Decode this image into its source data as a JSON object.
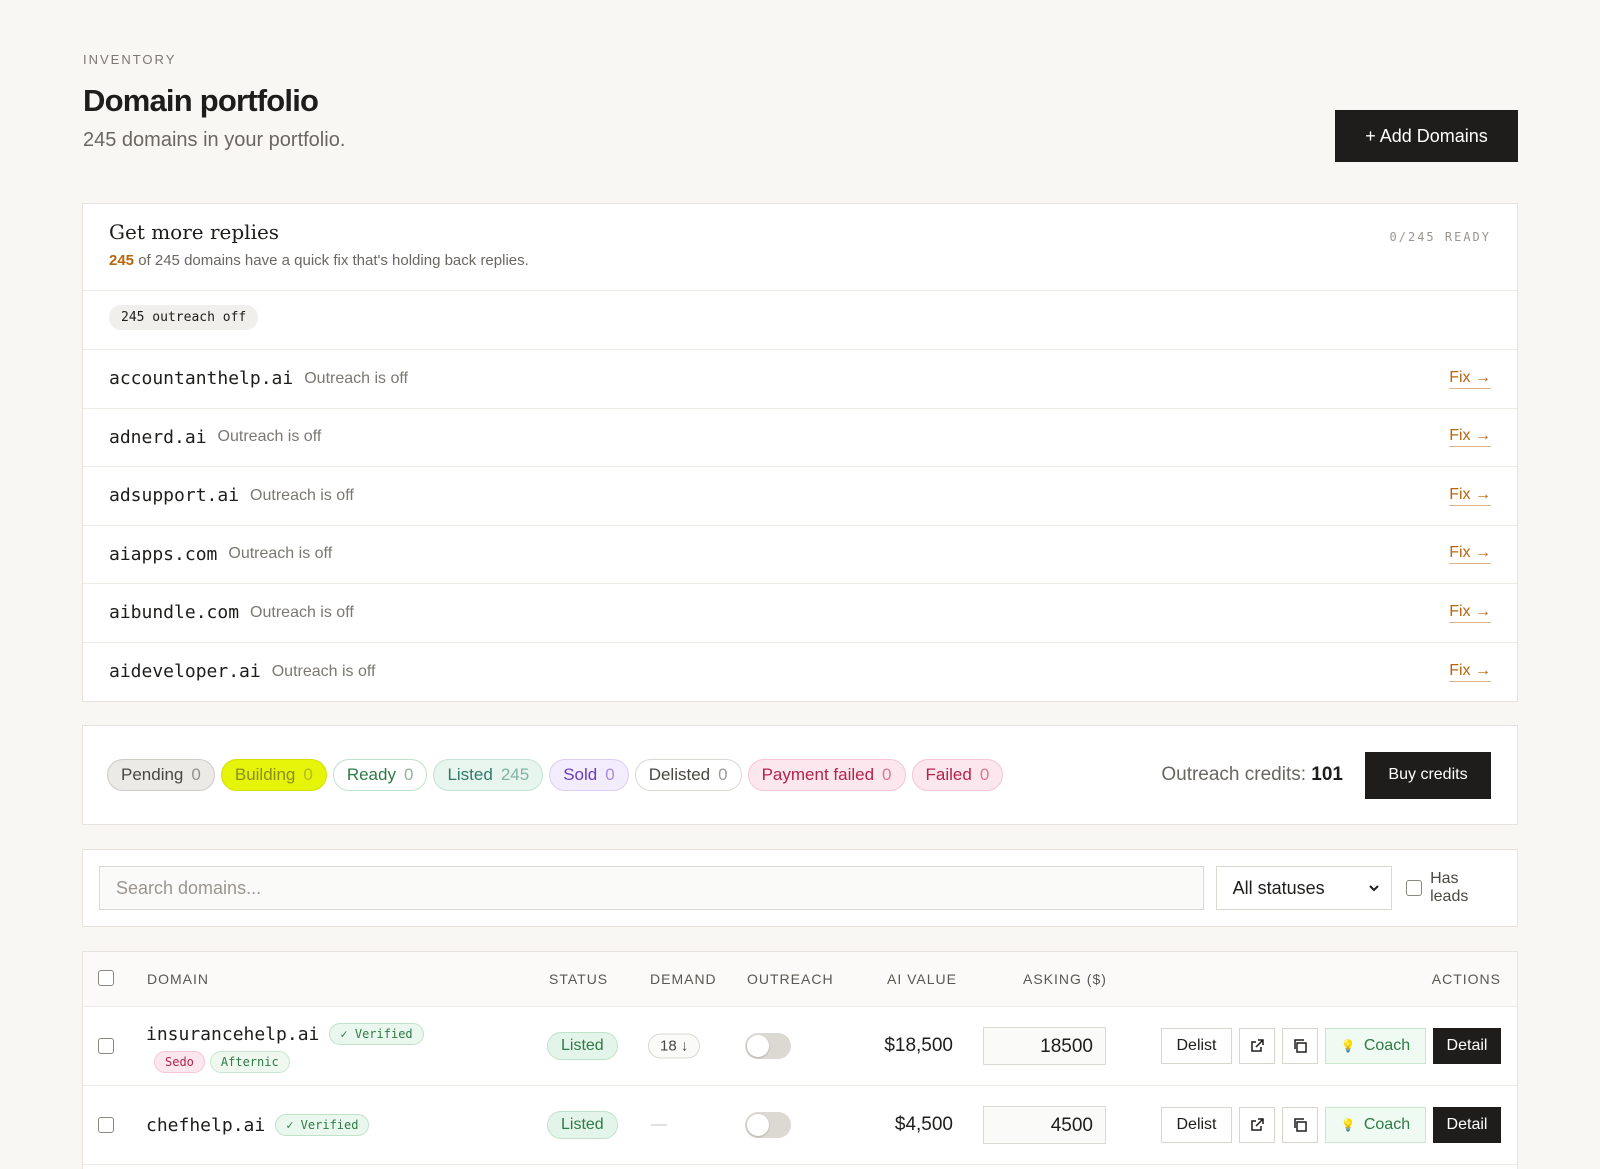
{
  "header": {
    "eyebrow": "INVENTORY",
    "title": "Domain portfolio",
    "subtitle": "245 domains in your portfolio.",
    "add_button": "+ Add Domains"
  },
  "replies": {
    "title": "Get more replies",
    "count": "245",
    "desc_rest": " of 245 domains have a quick fix that's holding back replies.",
    "ready": "0/245 READY",
    "chip": "245 outreach off",
    "fix_label": "Fix →",
    "items": [
      {
        "domain": "accountanthelp.ai",
        "note": "Outreach is off"
      },
      {
        "domain": "adnerd.ai",
        "note": "Outreach is off"
      },
      {
        "domain": "adsupport.ai",
        "note": "Outreach is off"
      },
      {
        "domain": "aiapps.com",
        "note": "Outreach is off"
      },
      {
        "domain": "aibundle.com",
        "note": "Outreach is off"
      },
      {
        "domain": "aideveloper.ai",
        "note": "Outreach is off"
      }
    ]
  },
  "statuses": {
    "pills": [
      {
        "label": "Pending",
        "count": "0",
        "bg": "#eceae6",
        "fg": "#4a4843",
        "border": "#cfccc6"
      },
      {
        "label": "Building",
        "count": "0",
        "bg": "#e6f40a",
        "fg": "#8a8f20",
        "border": "#d6e000"
      },
      {
        "label": "Ready",
        "count": "0",
        "bg": "#ffffff",
        "fg": "#2f7a45",
        "border": "#bfe3c9"
      },
      {
        "label": "Listed",
        "count": "245",
        "bg": "#e7f5ee",
        "fg": "#2f7a6a",
        "border": "#bfe3d6"
      },
      {
        "label": "Sold",
        "count": "0",
        "bg": "#f3ecfc",
        "fg": "#6a3db8",
        "border": "#ddcdf4"
      },
      {
        "label": "Delisted",
        "count": "0",
        "bg": "#ffffff",
        "fg": "#4a4843",
        "border": "#dcd9d3"
      },
      {
        "label": "Payment failed",
        "count": "0",
        "bg": "#fde7ee",
        "fg": "#b3234c",
        "border": "#f7c5d4"
      },
      {
        "label": "Failed",
        "count": "0",
        "bg": "#fde7ee",
        "fg": "#b3234c",
        "border": "#f7c5d4"
      }
    ],
    "credits_label": "Outreach credits: ",
    "credits_value": "101",
    "buy_button": "Buy credits"
  },
  "filters": {
    "search_placeholder": "Search domains...",
    "status_select": "All statuses",
    "has_leads": "Has leads"
  },
  "table": {
    "columns": {
      "domain": "DOMAIN",
      "status": "STATUS",
      "demand": "DEMAND",
      "outreach": "OUTREACH",
      "ai_value": "AI VALUE",
      "asking": "ASKING ($)",
      "actions": "ACTIONS"
    },
    "actions": {
      "delist": "Delist",
      "coach": "Coach",
      "detail": "Detail"
    },
    "rows": [
      {
        "domain": "insurancehelp.ai",
        "verified": "✓ Verified",
        "tags": [
          "Sedo",
          "Afternic"
        ],
        "status": "Listed",
        "demand": "18 ↓",
        "ai_value": "$18,500",
        "asking": "18500"
      },
      {
        "domain": "chefhelp.ai",
        "verified": "✓ Verified",
        "tags": [],
        "status": "Listed",
        "demand": "—",
        "ai_value": "$4,500",
        "asking": "4500"
      }
    ]
  }
}
